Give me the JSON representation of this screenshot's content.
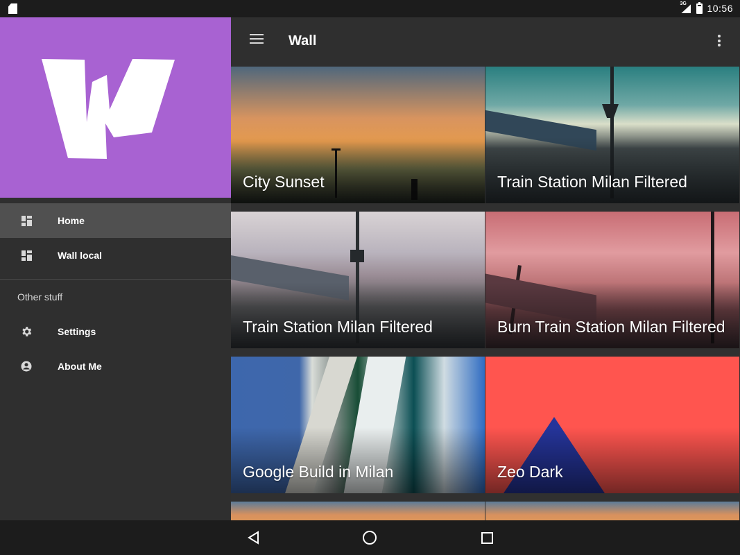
{
  "status_bar": {
    "network": "3G",
    "battery_percent": 80,
    "time": "10:56",
    "icons": [
      "sd-card-icon",
      "signal-icon",
      "battery-icon"
    ]
  },
  "drawer": {
    "logo_color": "#a862d2",
    "items": [
      {
        "label": "Home",
        "icon": "dashboard-icon",
        "active": true
      },
      {
        "label": "Wall local",
        "icon": "dashboard-icon",
        "active": false
      }
    ],
    "section_title": "Other stuff",
    "secondary_items": [
      {
        "label": "Settings",
        "icon": "gear-icon"
      },
      {
        "label": "About Me",
        "icon": "account-circle-icon"
      }
    ]
  },
  "app_bar": {
    "title": "Wall",
    "menu_icon": "menu-icon",
    "more_icon": "more-vert-icon"
  },
  "wallpapers": [
    {
      "title": "City Sunset"
    },
    {
      "title": "Train Station Milan Filtered"
    },
    {
      "title": "Train Station Milan Filtered"
    },
    {
      "title": "Burn Train Station Milan Filtered"
    },
    {
      "title": "Google Build in Milan"
    },
    {
      "title": "Zeo Dark"
    }
  ],
  "navigation_bar": {
    "icons": [
      "back-icon",
      "home-icon",
      "recent-apps-icon"
    ]
  }
}
